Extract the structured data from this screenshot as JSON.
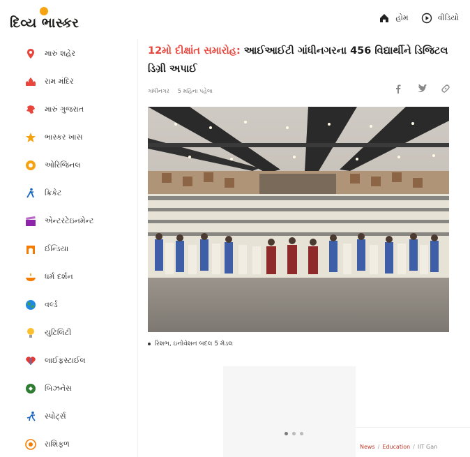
{
  "header": {
    "logo": "દિવ્ય ભાસ્કર",
    "nav": [
      {
        "label": "હોમ",
        "icon": "home-icon"
      },
      {
        "label": "વીડિયો",
        "icon": "play-icon"
      }
    ]
  },
  "sidebar": {
    "items": [
      {
        "label": "મારું શહેર",
        "icon": "location-pin-icon",
        "color": "#e8453c"
      },
      {
        "label": "રામ મંદિર",
        "icon": "temple-icon",
        "color": "#e8453c"
      },
      {
        "label": "મારું ગુજરાત",
        "icon": "gujarat-map-icon",
        "color": "#e8453c"
      },
      {
        "label": "ભાસ્કર ખાસ",
        "icon": "star-icon",
        "color": "#f6a313"
      },
      {
        "label": "ઓરિજિનલ",
        "icon": "original-icon",
        "color": "#f6a313"
      },
      {
        "label": "ક્રિકેટ",
        "icon": "cricket-icon",
        "color": "#1565c0"
      },
      {
        "label": "એન્ટરટેઇનમેન્ટ",
        "icon": "clapperboard-icon",
        "color": "#8e24aa"
      },
      {
        "label": "ઈન્ડિયા",
        "icon": "india-gate-icon",
        "color": "#f57c00"
      },
      {
        "label": "ધર્મ દર્શન",
        "icon": "lamp-icon",
        "color": "#f57c00"
      },
      {
        "label": "વર્લ્ડ",
        "icon": "globe-icon",
        "color": "#2e7d32"
      },
      {
        "label": "યુટિલિટી",
        "icon": "bulb-icon",
        "color": "#fbc02d"
      },
      {
        "label": "લાઈફસ્ટાઈલ",
        "icon": "heart-icon",
        "color": "#e53935"
      },
      {
        "label": "બિઝનેસ",
        "icon": "business-icon",
        "color": "#2e7d32"
      },
      {
        "label": "સ્પોર્ટ્સ",
        "icon": "runner-icon",
        "color": "#1565c0"
      },
      {
        "label": "રાશિફળ",
        "icon": "zodiac-icon",
        "color": "#f57c00"
      }
    ]
  },
  "article": {
    "headline_accent": "12મો દીક્ષાંત સમારોહ:",
    "headline_rest": " આઈઆઈટી ગાંધીનગરના 456 વિદ્યાર્થીને ડિજિટલ ડિગ્રી અપાઈ",
    "location": "ગાંધીનગર",
    "time": "5 મહિના પહેલા",
    "share": [
      {
        "label": "f",
        "icon": "facebook-icon"
      },
      {
        "label": "🐦",
        "icon": "twitter-icon"
      },
      {
        "label": "🔗",
        "icon": "link-icon"
      }
    ],
    "caption": "રિશભ, ઇનોવેશન બદલ 5 મેડલ"
  },
  "carousel": {
    "count": 3,
    "active": 0
  },
  "breadcrumb": [
    "News",
    "Education",
    "IIT Gan"
  ],
  "colors": {
    "accent": "#e8453c",
    "logo_dot": "#f6a313"
  }
}
